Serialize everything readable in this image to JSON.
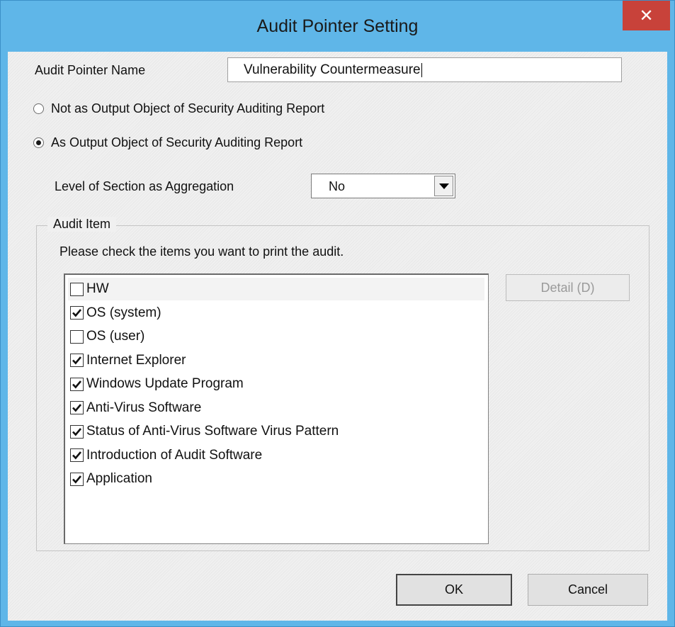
{
  "window": {
    "title": "Audit Pointer Setting",
    "close_symbol": "✕"
  },
  "form": {
    "name_label": "Audit Pointer Name",
    "name_value": "Vulnerability Countermeasure",
    "radio_not_output": "Not as Output Object of Security Auditing Report",
    "radio_output": "As Output Object of Security Auditing Report",
    "selected_radio": "As Output Object of Security Auditing Report",
    "section_label": "Level of Section as Aggregation",
    "section_value": "No"
  },
  "audit_item": {
    "group_title": "Audit Item",
    "instruction": "Please check the items you want to print the audit.",
    "items": [
      {
        "label": "HW",
        "checked": false
      },
      {
        "label": "OS (system)",
        "checked": true
      },
      {
        "label": "OS (user)",
        "checked": false
      },
      {
        "label": "Internet Explorer",
        "checked": true
      },
      {
        "label": "Windows Update Program",
        "checked": true
      },
      {
        "label": "Anti-Virus Software",
        "checked": true
      },
      {
        "label": "Status of Anti-Virus Software Virus Pattern",
        "checked": true
      },
      {
        "label": "Introduction of Audit Software",
        "checked": true
      },
      {
        "label": "Application",
        "checked": true
      }
    ],
    "detail_button": "Detail (D)"
  },
  "buttons": {
    "ok": "OK",
    "cancel": "Cancel"
  },
  "colors": {
    "titlebar": "#5fb6e8",
    "close": "#c8423a",
    "client": "#f0f0f0"
  }
}
